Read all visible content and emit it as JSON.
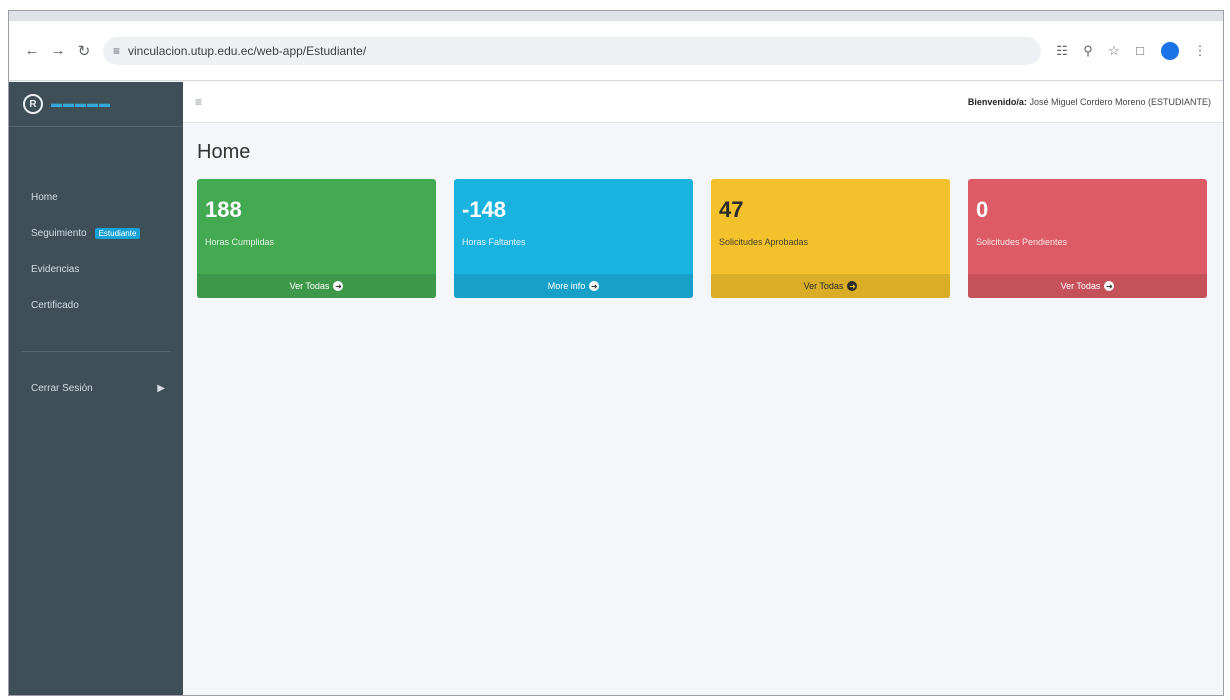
{
  "browser": {
    "url": "vinculacion.utup.edu.ec/web-app/Estudiante/"
  },
  "sidebar": {
    "items": [
      {
        "label": "Home"
      },
      {
        "label": "Seguimiento",
        "badge": "Estudiante"
      },
      {
        "label": "Evidencias"
      },
      {
        "label": "Certificado"
      }
    ],
    "logout": "Cerrar Sesión"
  },
  "header": {
    "welcome_prefix": "Bienvenido/a:",
    "welcome_user": "José Miguel Cordero Moreno (ESTUDIANTE)"
  },
  "page": {
    "title": "Home"
  },
  "cards": [
    {
      "value": "188",
      "label": "Horas Cumplidas",
      "footer": "Ver Todas",
      "color": "#44aa52"
    },
    {
      "value": "-148",
      "label": "Horas Faltantes",
      "footer": "More info",
      "color": "#1ab3df"
    },
    {
      "value": "47",
      "label": "Solicitudes Aprobadas",
      "footer": "Ver Todas",
      "color": "#f3c12c"
    },
    {
      "value": "0",
      "label": "Solicitudes Pendientes",
      "footer": "Ver Todas",
      "color": "#dc5b66"
    }
  ],
  "colors": {
    "sidebar_bg": "#3e4f58",
    "badge": "#17a2d8"
  }
}
